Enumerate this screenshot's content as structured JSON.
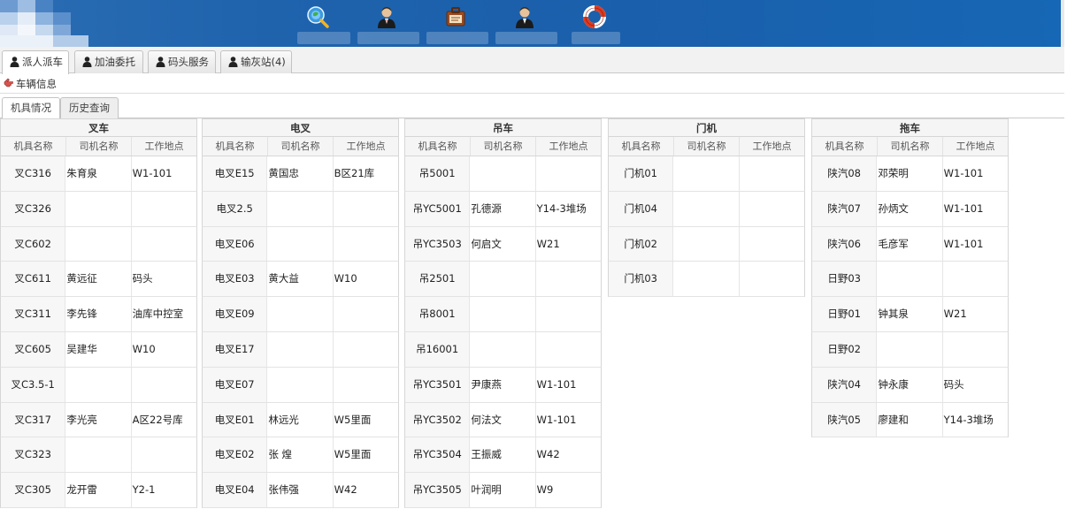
{
  "header": {
    "icons": [
      "search-globe-icon",
      "user-icon",
      "briefcase-icon",
      "user-icon",
      "lifebuoy-icon"
    ],
    "colors": {
      "bar": "#1f63ad"
    }
  },
  "main_tabs": [
    {
      "label": "派人派车",
      "active": true
    },
    {
      "label": "加油委托",
      "active": false
    },
    {
      "label": "码头服务",
      "active": false
    },
    {
      "label": "输灰站(4)",
      "active": false
    }
  ],
  "section": {
    "title": "车辆信息"
  },
  "sub_tabs": [
    {
      "label": "机具情况",
      "active": true
    },
    {
      "label": "历史查询",
      "active": false
    }
  ],
  "panels": [
    {
      "title": "叉车",
      "columns": [
        "机具名称",
        "司机名称",
        "工作地点"
      ],
      "rows": [
        [
          "叉C316",
          "朱育泉",
          "W1-101"
        ],
        [
          "叉C326",
          "",
          ""
        ],
        [
          "叉C602",
          "",
          ""
        ],
        [
          "叉C611",
          "黄远征",
          "码头"
        ],
        [
          "叉C311",
          "李先锋",
          "油库中控室"
        ],
        [
          "叉C605",
          "吴建华",
          "W10"
        ],
        [
          "叉C3.5-1",
          "",
          ""
        ],
        [
          "叉C317",
          "李光亮",
          "A区22号库"
        ],
        [
          "叉C323",
          "",
          ""
        ],
        [
          "叉C305",
          "龙开雷",
          "Y2-1"
        ]
      ]
    },
    {
      "title": "电叉",
      "columns": [
        "机具名称",
        "司机名称",
        "工作地点"
      ],
      "rows": [
        [
          "电叉E15",
          "黄国忠",
          "B区21库"
        ],
        [
          "电叉2.5",
          "",
          ""
        ],
        [
          "电叉E06",
          "",
          ""
        ],
        [
          "电叉E03",
          "黄大益",
          "W10"
        ],
        [
          "电叉E09",
          "",
          ""
        ],
        [
          "电叉E17",
          "",
          ""
        ],
        [
          "电叉E07",
          "",
          ""
        ],
        [
          "电叉E01",
          "林远光",
          "W5里面"
        ],
        [
          "电叉E02",
          "张 煌",
          "W5里面"
        ],
        [
          "电叉E04",
          "张伟强",
          "W42"
        ]
      ]
    },
    {
      "title": "吊车",
      "columns": [
        "机具名称",
        "司机名称",
        "工作地点"
      ],
      "rows": [
        [
          "吊5001",
          "",
          ""
        ],
        [
          "吊YC5001",
          "孔德源",
          "Y14-3堆场"
        ],
        [
          "吊YC3503",
          "何启文",
          "W21"
        ],
        [
          "吊2501",
          "",
          ""
        ],
        [
          "吊8001",
          "",
          ""
        ],
        [
          "吊16001",
          "",
          ""
        ],
        [
          "吊YC3501",
          "尹康燕",
          "W1-101"
        ],
        [
          "吊YC3502",
          "何法文",
          "W1-101"
        ],
        [
          "吊YC3504",
          "王振威",
          "W42"
        ],
        [
          "吊YC3505",
          "叶润明",
          "W9"
        ]
      ]
    },
    {
      "title": "门机",
      "columns": [
        "机具名称",
        "司机名称",
        "工作地点"
      ],
      "rows": [
        [
          "门机01",
          "",
          ""
        ],
        [
          "门机04",
          "",
          ""
        ],
        [
          "门机02",
          "",
          ""
        ],
        [
          "门机03",
          "",
          ""
        ]
      ]
    },
    {
      "title": "拖车",
      "columns": [
        "机具名称",
        "司机名称",
        "工作地点"
      ],
      "rows": [
        [
          "陕汽08",
          "邓荣明",
          "W1-101"
        ],
        [
          "陕汽07",
          "孙炳文",
          "W1-101"
        ],
        [
          "陕汽06",
          "毛彦军",
          "W1-101"
        ],
        [
          "日野03",
          "",
          ""
        ],
        [
          "日野01",
          "钟其泉",
          "W21"
        ],
        [
          "日野02",
          "",
          ""
        ],
        [
          "陕汽04",
          "钟永康",
          "码头"
        ],
        [
          "陕汽05",
          "廖建和",
          "Y14-3堆场"
        ]
      ]
    }
  ]
}
